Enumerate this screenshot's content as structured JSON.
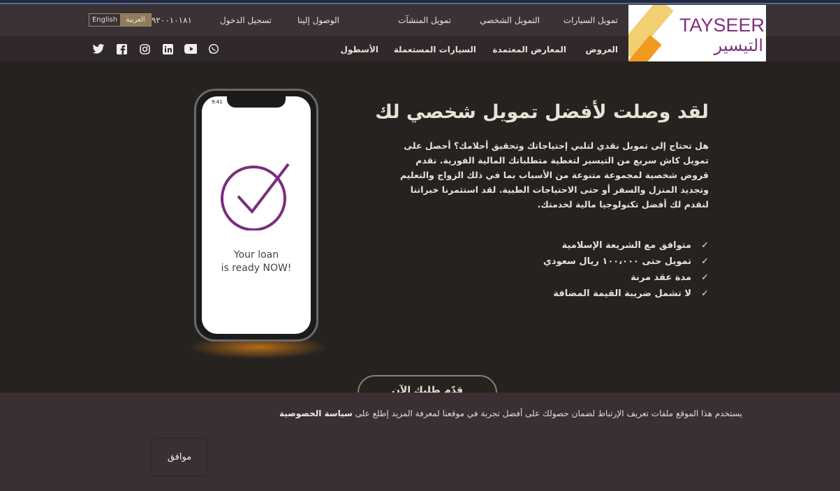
{
  "header": {
    "top_nav": [
      "تمويل السيارات",
      "التمويل الشخصي",
      "تمويل المنشآت",
      "الوصول إلينا",
      "تسجيل الدخول",
      "٩٢٠٠١٠١٨١"
    ],
    "lang": {
      "arabic": "العربية",
      "english": "English"
    },
    "sub_nav": [
      "العروض",
      "المعارض المعتمدة",
      "السيارات المستعملة",
      "الأسطول"
    ],
    "social_icons": [
      "twitter-icon",
      "facebook-icon",
      "instagram-icon",
      "linkedin-icon",
      "youtube-icon",
      "whatsapp-icon"
    ],
    "logo": {
      "en": "TAYSEER",
      "ar": "التيسير"
    }
  },
  "phone": {
    "time": "9:41",
    "message_line1": "Your loan",
    "message_line2": "is ready NOW!",
    "accent": "#7a2e7c"
  },
  "hero": {
    "title": "لقد وصلت لأفضل تمويل شخصي لك",
    "text": "هل تحتاج إلى تمويل نقدي لتلبي إحتياجاتك وتحقيق أحلامك؟ أحصل على تمويل كاش سريع من التيسير لتغطية متطلباتك المالية الفورية. نقدم قروض شخصية لمجموعة متنوعة من الأسباب بما في ذلك الزواج والتعليم وتجديد المنزل والسفر أو حتى الاحتياجات الطبية. لقد استثمرنا خبراتنا لنقدم لك أفضل تكنولوجيا مالية لخدمتك.",
    "features": [
      "متوافق مع الشريعة الإسلامية",
      "تمويل حتى ١٠٠،٠٠٠ ريال سعودي",
      "مدة عقد مرنة",
      "لا تشمل ضريبة القيمة المضافة"
    ],
    "check": "✓",
    "cta": "قدّم طلبك الآن"
  },
  "cookie": {
    "text": "يستخدم هذا الموقع ملفات تعريف الإرتباط لضمان حصولك على أفضل تجربة في موقعنا لمعرفة المزيد إطلع على",
    "link": "سياسة الخصوصية",
    "agree": "موافق"
  }
}
